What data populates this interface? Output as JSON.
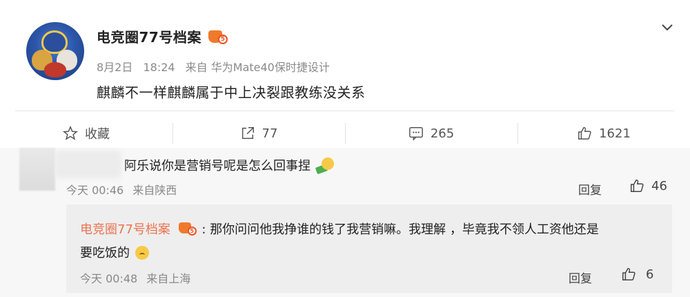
{
  "post": {
    "author": "电竞圈77号档案",
    "badge_level": "5",
    "date": "8月2日",
    "time": "18:24",
    "source": "来自 华为Mate40保时捷设计",
    "content": "麒麟不一样麒麟属于中上决裂跟教练没关系"
  },
  "actions": {
    "favorite_label": "收藏",
    "repost_count": "77",
    "comment_count": "265",
    "like_count": "1621"
  },
  "comment": {
    "text": "阿乐说你是营销号呢是怎么回事捏",
    "time": "今天 00:46",
    "source": "来自陕西",
    "reply_label": "回复",
    "like_count": "46"
  },
  "reply": {
    "author": "电竞圈77号档案",
    "badge_level": "5",
    "separator": ":",
    "text_line1": "那你问问他我挣谁的钱了我营销嘛。我理解 ，毕竟我不领人工资他还是",
    "text_line2": "要吃饭的",
    "time": "今天 00:48",
    "source": "来自上海",
    "reply_label": "回复",
    "like_count": "6"
  },
  "colors": {
    "accent_orange": "#eb7350",
    "badge_orange": "#f07a2b"
  }
}
